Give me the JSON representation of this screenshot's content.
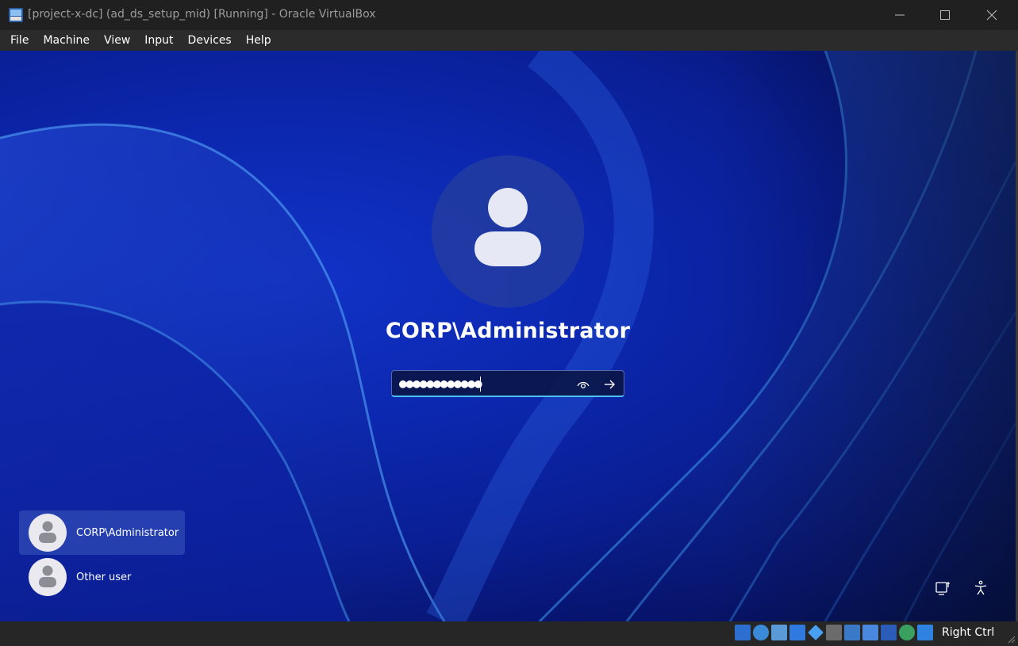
{
  "window": {
    "title": "[project-x-dc] (ad_ds_setup_mid) [Running] - Oracle VirtualBox"
  },
  "menu": {
    "items": [
      "File",
      "Machine",
      "View",
      "Input",
      "Devices",
      "Help"
    ]
  },
  "login": {
    "username": "CORP\\Administrator",
    "password_mask": "●●●●●●●●●●●●"
  },
  "user_list": [
    {
      "label": "CORP\\Administrator",
      "selected": true
    },
    {
      "label": "Other user",
      "selected": false
    }
  ],
  "corner_icons": [
    "network-icon",
    "accessibility-icon"
  ],
  "statusbar": {
    "icons": [
      "hard-disk-icon",
      "optical-drive-icon",
      "audio-icon",
      "network-adapters-icon",
      "usb-icon",
      "shared-folders-icon",
      "display-icon",
      "recording-icon",
      "virtualization-icon",
      "mouse-integration-icon",
      "keyboard-capture-icon"
    ],
    "host_key": "Right Ctrl"
  },
  "colors": {
    "accent": "#4cc2ff",
    "titlebar": "#202020",
    "menubar": "#2b2b2b",
    "statusbar": "#262626"
  }
}
